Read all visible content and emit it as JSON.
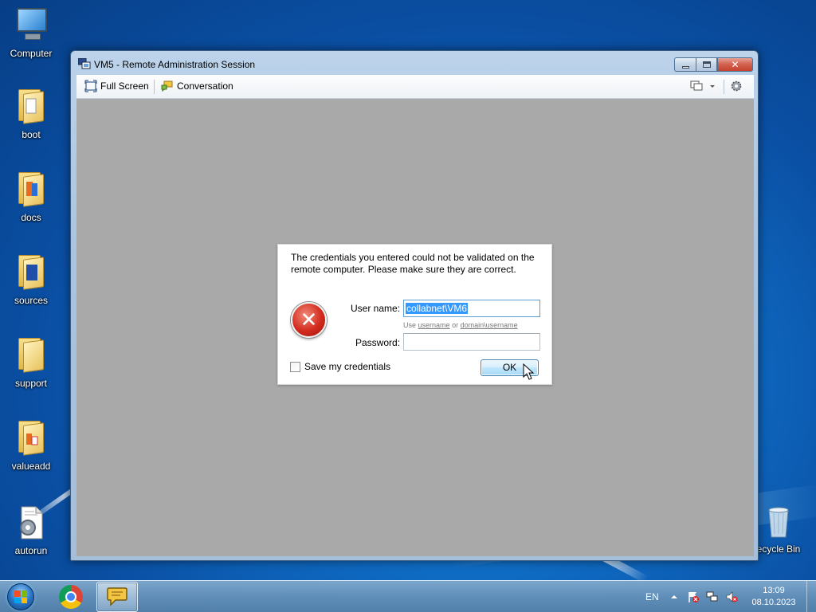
{
  "desktop": {
    "icons": [
      {
        "label": "Computer",
        "icon": "computer-icon"
      },
      {
        "label": "boot",
        "icon": "folder-icon"
      },
      {
        "label": "docs",
        "icon": "folder-icon"
      },
      {
        "label": "sources",
        "icon": "folder-icon"
      },
      {
        "label": "support",
        "icon": "folder-icon"
      },
      {
        "label": "valueadd",
        "icon": "folder-icon"
      },
      {
        "label": "autorun",
        "icon": "settings-file-icon"
      },
      {
        "label": "ecycle Bin",
        "icon": "recycle-bin-icon"
      }
    ]
  },
  "window": {
    "title": "VM5 - Remote Administration Session",
    "toolbar": {
      "full_screen": "Full Screen",
      "conversation": "Conversation"
    }
  },
  "dialog": {
    "message": "The credentials you entered could not be validated on the remote computer. Please make sure they are correct.",
    "username_label": "User name:",
    "username_value": "collabnet\\VM6",
    "hint_use": "Use",
    "hint_username": "username",
    "hint_or": "or",
    "hint_domain_username": "domain\\username",
    "password_label": "Password:",
    "password_value": "",
    "save_credentials_label": "Save my credentials",
    "save_credentials_checked": false,
    "ok_label": "OK"
  },
  "taskbar": {
    "language": "EN",
    "time": "13:09",
    "date": "08.10.2023"
  },
  "colors": {
    "selection": "#3399ff",
    "content_bg": "#a9a9a9",
    "error_red": "#d32b1e"
  }
}
